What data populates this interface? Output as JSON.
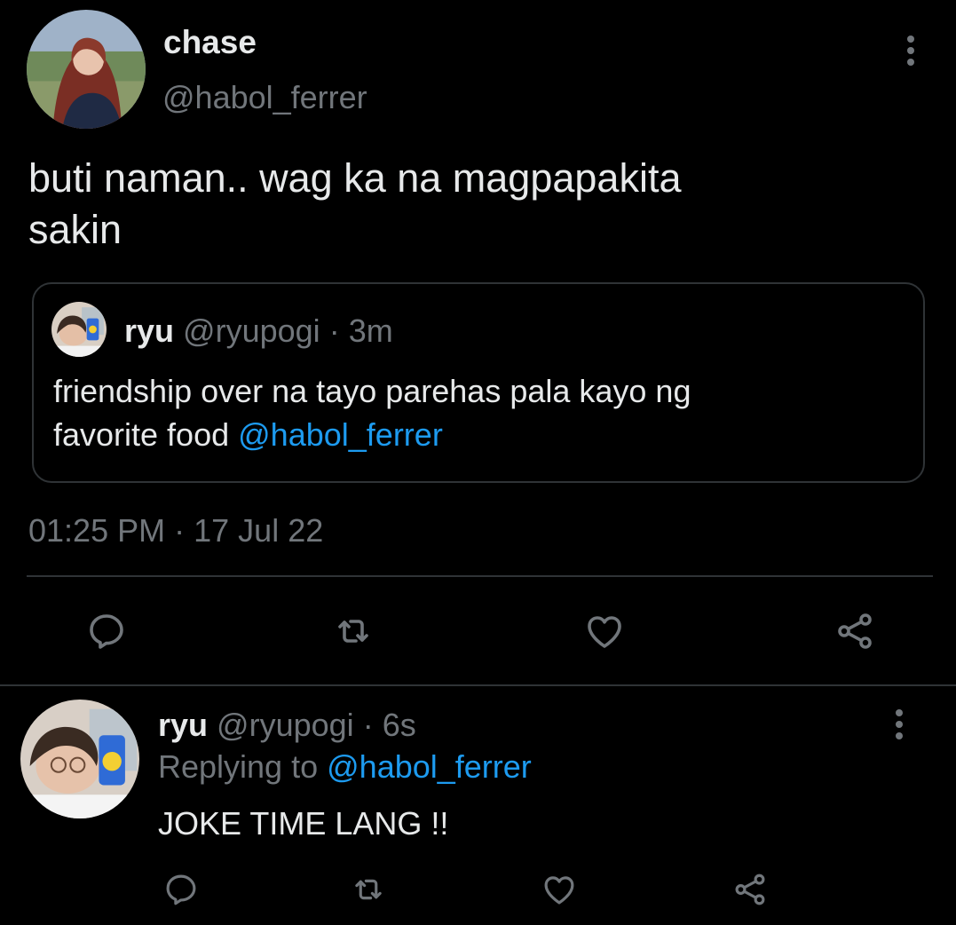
{
  "main_tweet": {
    "display_name": "chase",
    "handle": "@habol_ferrer",
    "text_line1": "buti naman.. wag ka na magpapakita",
    "text_line2": "sakin",
    "timestamp": "01:25 PM",
    "separator": "·",
    "date": "17 Jul 22"
  },
  "quoted_tweet": {
    "display_name": "ryu",
    "handle": "@ryupogi",
    "separator": "·",
    "age": "3m",
    "text_line1": "friendship over na tayo parehas pala kayo ng",
    "text_line2_prefix": "favorite food",
    "mention": "@habol_ferrer"
  },
  "reply_tweet": {
    "display_name": "ryu",
    "handle": "@ryupogi",
    "separator": "·",
    "age": "6s",
    "replying_prefix": "Replying to",
    "replying_mention": "@habol_ferrer",
    "text": "JOKE TIME LANG !!"
  },
  "icons": {
    "more": "more-vertical-icon",
    "reply": "reply-icon",
    "retweet": "retweet-icon",
    "like": "heart-icon",
    "share": "share-icon"
  },
  "colors": {
    "background": "#000000",
    "text": "#e7e9ea",
    "secondary": "#71767b",
    "accent": "#1d9bf0",
    "border": "#2f3336"
  }
}
